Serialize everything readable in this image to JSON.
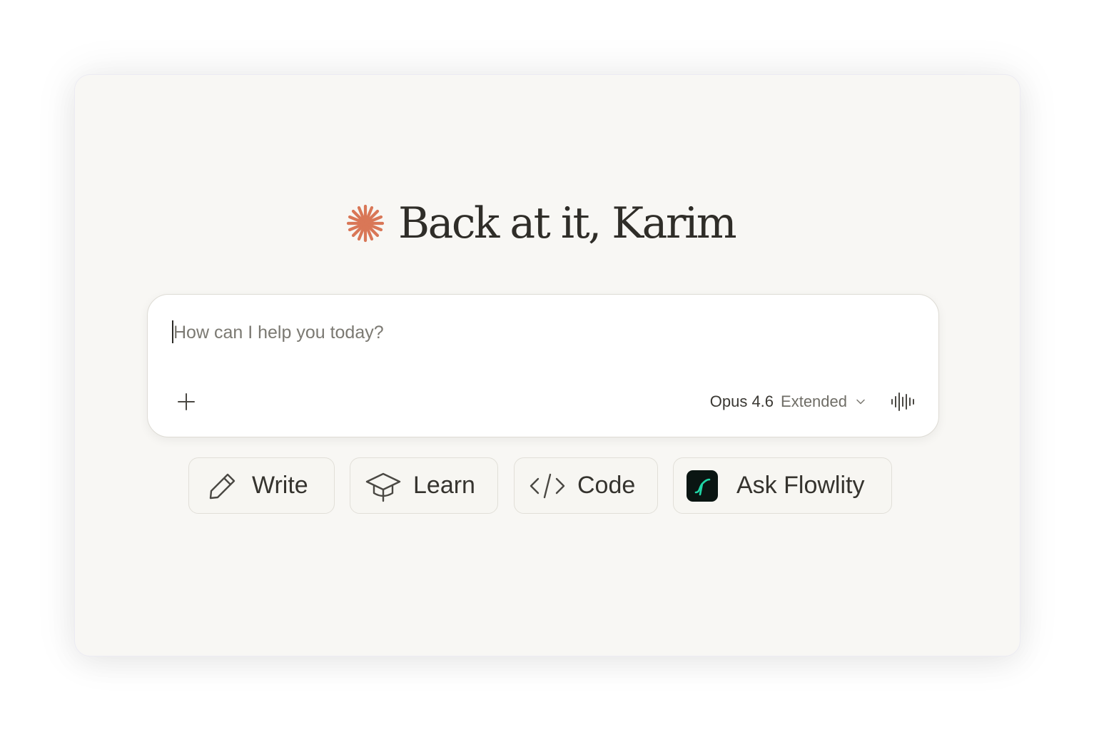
{
  "greeting": {
    "text": "Back at it, Karim",
    "icon": "spark-logo-icon",
    "accent_color": "#d97757"
  },
  "composer": {
    "placeholder": "How can I help you today?",
    "value": "",
    "add_icon": "plus-icon",
    "model_name": "Opus 4.6",
    "model_mode": "Extended",
    "model_dropdown_icon": "chevron-down-icon",
    "voice_icon": "voice-waveform-icon"
  },
  "quick_actions": [
    {
      "label": "Write",
      "icon": "pencil-icon"
    },
    {
      "label": "Learn",
      "icon": "graduation-cap-icon"
    },
    {
      "label": "Code",
      "icon": "code-icon"
    },
    {
      "label": "Ask Flowlity",
      "icon": "flowlity-logo-icon",
      "brand_color": "#1fd6a6"
    }
  ]
}
